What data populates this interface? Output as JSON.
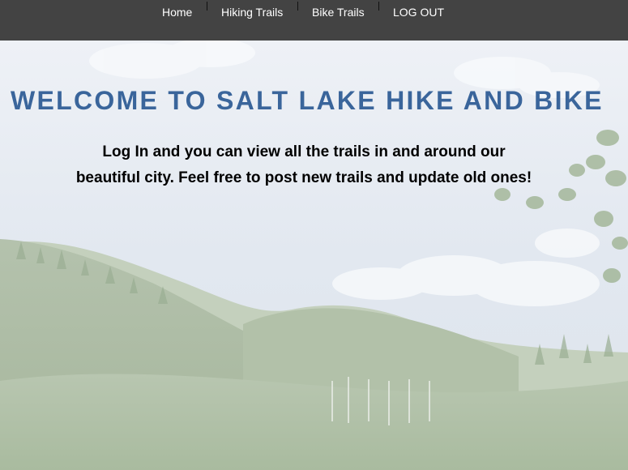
{
  "nav": {
    "items": [
      {
        "label": "Home"
      },
      {
        "label": "Hiking Trails"
      },
      {
        "label": "Bike Trails"
      },
      {
        "label": "LOG OUT"
      }
    ]
  },
  "hero": {
    "headline": "WELCOME TO SALT LAKE HIKE AND BIKE",
    "intro_line1": "Log In and you can view all the trails in and around our",
    "intro_line2": "beautiful city. Feel free to post new trails and update old ones!"
  },
  "colors": {
    "navbar_bg": "#434343",
    "nav_text": "#ffffff",
    "headline": "#3a659b",
    "body_text": "#000000",
    "sky": "#e6ebf2",
    "hills": "#a8b8a0"
  }
}
